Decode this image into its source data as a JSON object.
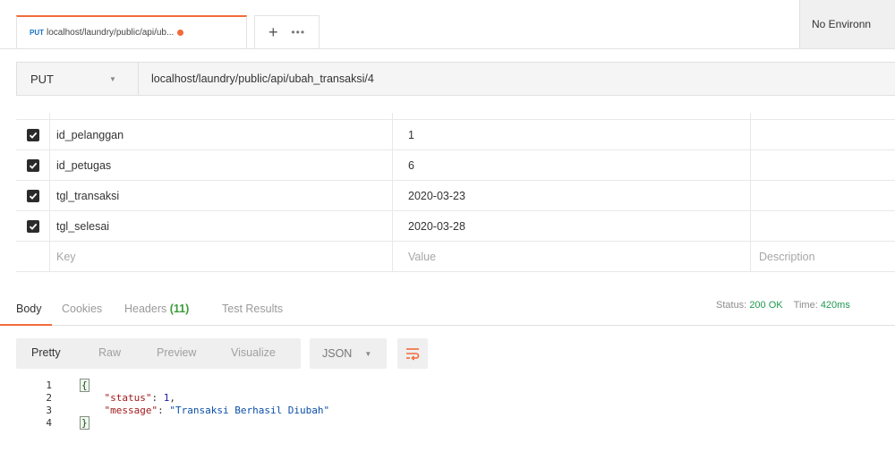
{
  "tabbar": {
    "tab": {
      "method": "PUT",
      "url": "localhost/laundry/public/api/ub..."
    },
    "new_tab_symbol": "+",
    "more_symbol": "•••",
    "environment": "No Environn"
  },
  "request": {
    "method": "PUT",
    "url": "localhost/laundry/public/api/ubah_transaksi/4"
  },
  "params": {
    "rows": [
      {
        "key": "id_pelanggan",
        "value": "1",
        "description": "",
        "checked": true
      },
      {
        "key": "id_petugas",
        "value": "6",
        "description": "",
        "checked": true
      },
      {
        "key": "tgl_transaksi",
        "value": "2020-03-23",
        "description": "",
        "checked": true
      },
      {
        "key": "tgl_selesai",
        "value": "2020-03-28",
        "description": "",
        "checked": true
      }
    ],
    "placeholder": {
      "key": "Key",
      "value": "Value",
      "description": "Description"
    }
  },
  "response": {
    "tabs": {
      "body": "Body",
      "cookies": "Cookies",
      "headers": "Headers",
      "headers_count": "(11)",
      "test_results": "Test Results"
    },
    "status_label": "Status:",
    "status_value": "200 OK",
    "time_label": "Time:",
    "time_value": "420ms",
    "formats": {
      "pretty": "Pretty",
      "raw": "Raw",
      "preview": "Preview",
      "visualize": "Visualize"
    },
    "language": "JSON",
    "code": {
      "line_numbers": [
        "1",
        "2",
        "3",
        "4"
      ],
      "open_brace": "{",
      "close_brace": "}",
      "status_key": "\"status\"",
      "status_value": "1",
      "message_key": "\"message\"",
      "message_value": "\"Transaksi Berhasil Diubah\""
    }
  },
  "colors": {
    "accent": "#f26b3a",
    "status_ok": "#1f9a50",
    "method_blue": "#1a73c6"
  }
}
